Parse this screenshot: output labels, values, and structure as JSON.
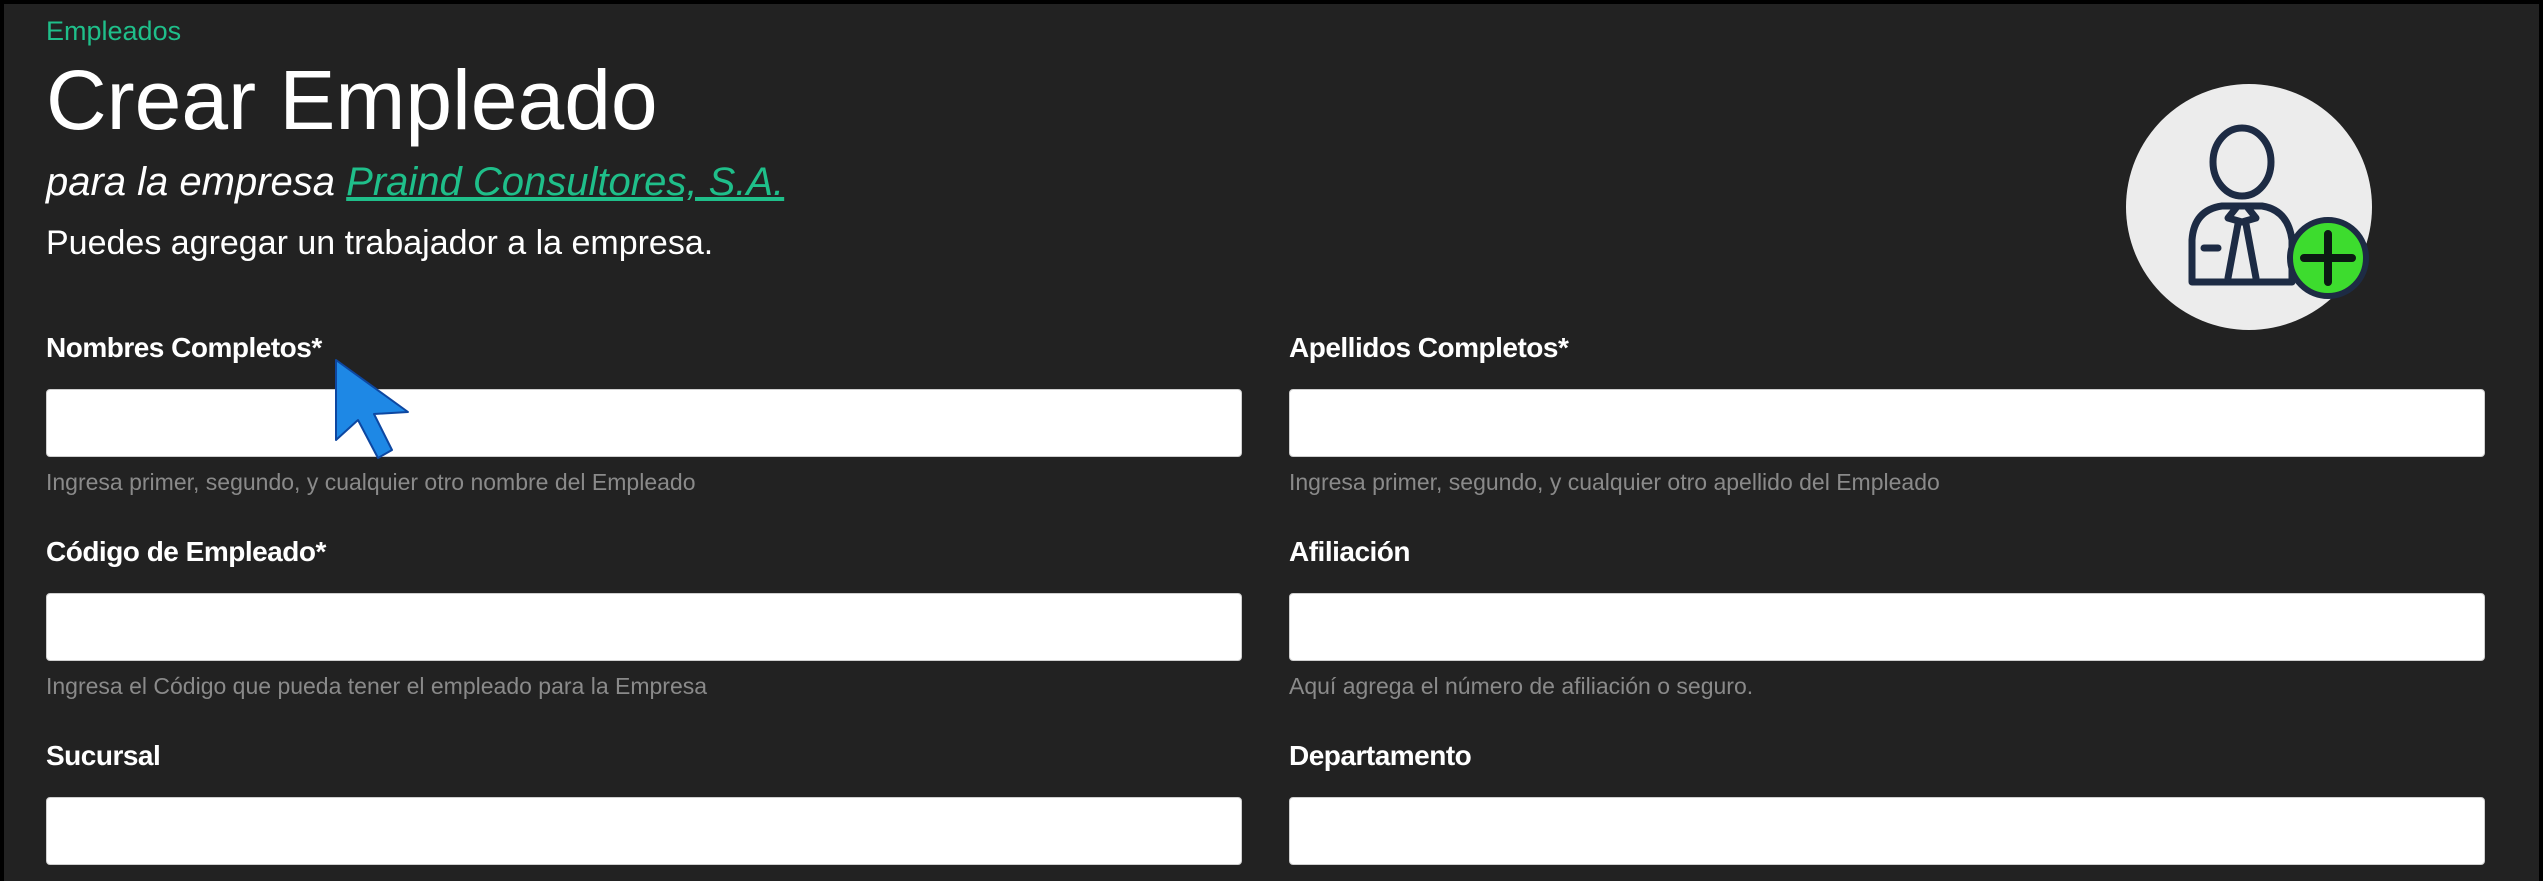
{
  "breadcrumb": {
    "label": "Empleados"
  },
  "header": {
    "title": "Crear Empleado",
    "subtitle_prefix": "para la empresa",
    "company_link": "Praind Consultores, S.A.",
    "description": "Puedes agregar un trabajador a la empresa."
  },
  "avatar": {
    "icon": "add-employee-icon"
  },
  "form": {
    "nombres": {
      "label": "Nombres Completos*",
      "value": "",
      "help": "Ingresa primer, segundo, y cualquier otro nombre del Empleado"
    },
    "apellidos": {
      "label": "Apellidos Completos*",
      "value": "",
      "help": "Ingresa primer, segundo, y cualquier otro apellido del Empleado"
    },
    "codigo": {
      "label": "Código de Empleado*",
      "value": "",
      "help": "Ingresa el Código que pueda tener el empleado para la Empresa"
    },
    "afiliacion": {
      "label": "Afiliación",
      "value": "",
      "help": "Aquí agrega el número de afiliación o seguro."
    },
    "sucursal": {
      "label": "Sucursal",
      "value": ""
    },
    "departamento": {
      "label": "Departamento",
      "value": ""
    }
  },
  "colors": {
    "accent": "#1fbf8a",
    "background": "#222222",
    "icon_plus": "#3ddc2e",
    "cursor": "#1e88e5"
  }
}
